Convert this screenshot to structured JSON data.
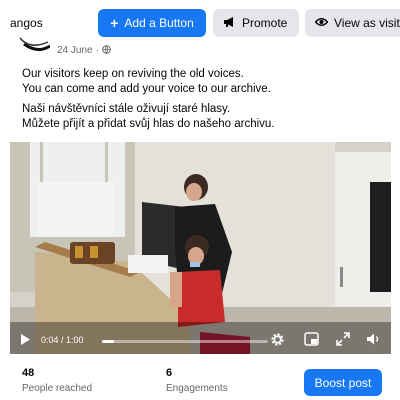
{
  "header": {
    "page_name": "angos",
    "add_button_label": "Add a Button",
    "promote_label": "Promote",
    "view_as_visitor_label": "View as visit"
  },
  "post": {
    "date": "24 June",
    "audience_icon": "globe-icon",
    "text_en": [
      "Our visitors keep on reviving the old voices.",
      "You can come and add your voice to our archive."
    ],
    "text_cs": [
      "Naši návštěvníci stále oživují staré hlasy.",
      "Můžete přijít a přidat svůj hlas do našeho archivu."
    ]
  },
  "video": {
    "current_time": "0:04",
    "duration": "1:00",
    "time_display": "0:04 / 1:00",
    "progress": 0.07,
    "icons": [
      "play-icon",
      "settings-icon",
      "picture-in-picture-icon",
      "fullscreen-icon",
      "volume-icon"
    ]
  },
  "stats": {
    "reach_value": "48",
    "reach_label": "People reached",
    "engagement_value": "6",
    "engagement_label": "Engagements"
  },
  "actions": {
    "boost_label": "Boost post"
  },
  "colors": {
    "primary": "#1877f2",
    "secondary_button": "#e4e6eb",
    "muted_text": "#65676b"
  }
}
